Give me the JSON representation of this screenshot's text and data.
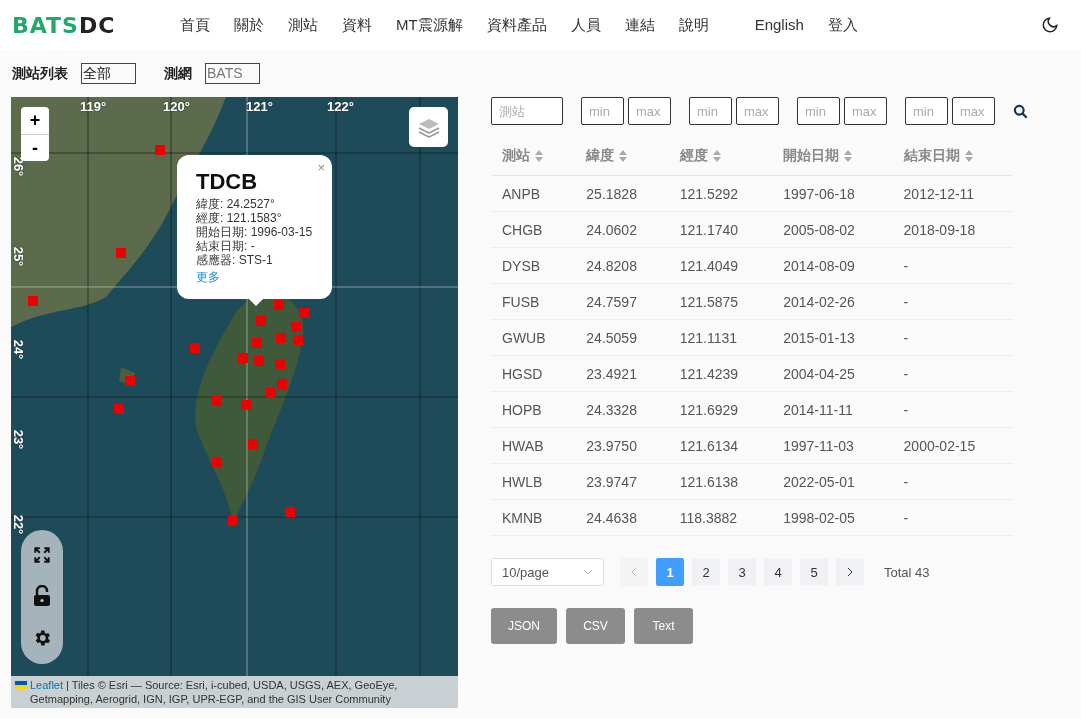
{
  "header": {
    "logo": {
      "accent": "BATS",
      "rest": "DC"
    },
    "nav": [
      "首頁",
      "關於",
      "測站",
      "資料",
      "MT震源解",
      "資料產品",
      "人員",
      "連結",
      "說明"
    ],
    "extra_nav": [
      "English",
      "登入"
    ]
  },
  "filters": [
    {
      "label": "測站列表",
      "value": "全部"
    },
    {
      "label": "測網",
      "value": "BATS"
    }
  ],
  "map": {
    "lon_labels": [
      "119°",
      "120°",
      "121°",
      "122°"
    ],
    "lat_labels": [
      "26°",
      "25°",
      "24°",
      "23°",
      "22°"
    ],
    "zoom_in": "+",
    "zoom_out": "-",
    "popup": {
      "title": "TDCB",
      "close": "×",
      "lines": [
        "緯度: 24.2527°",
        "經度: 121.1583°",
        "開始日期: 1996-03-15",
        "結束日期: -",
        "感應器: STS-1"
      ],
      "link": "更多"
    },
    "attribution": {
      "link": "Leaflet",
      "text": "| Tiles © Esri — Source: Esri, i-cubed, USDA, USGS, AEX, GeoEye, Getmapping, Aerogrid, IGN, IGP, UPR-EGP, and the GIS User Community"
    }
  },
  "search": {
    "station_placeholder": "測站",
    "ranges": [
      {
        "min_placeholder": "min",
        "max_placeholder": "max"
      },
      {
        "min_placeholder": "min",
        "max_placeholder": "max"
      },
      {
        "min_placeholder": "min",
        "max_placeholder": "max"
      },
      {
        "min_placeholder": "min",
        "max_placeholder": "max"
      }
    ]
  },
  "table": {
    "columns": [
      "測站",
      "緯度",
      "經度",
      "開始日期",
      "結束日期"
    ],
    "rows": [
      [
        "ANPB",
        "25.1828",
        "121.5292",
        "1997-06-18",
        "2012-12-11"
      ],
      [
        "CHGB",
        "24.0602",
        "121.1740",
        "2005-08-02",
        "2018-09-18"
      ],
      [
        "DYSB",
        "24.8208",
        "121.4049",
        "2014-08-09",
        "-"
      ],
      [
        "FUSB",
        "24.7597",
        "121.5875",
        "2014-02-26",
        "-"
      ],
      [
        "GWUB",
        "24.5059",
        "121.1131",
        "2015-01-13",
        "-"
      ],
      [
        "HGSD",
        "23.4921",
        "121.4239",
        "2004-04-25",
        "-"
      ],
      [
        "HOPB",
        "24.3328",
        "121.6929",
        "2014-11-11",
        "-"
      ],
      [
        "HWAB",
        "23.9750",
        "121.6134",
        "1997-11-03",
        "2000-02-15"
      ],
      [
        "HWLB",
        "23.9747",
        "121.6138",
        "2022-05-01",
        "-"
      ],
      [
        "KMNB",
        "24.4638",
        "118.3882",
        "1998-02-05",
        "-"
      ]
    ]
  },
  "pagination": {
    "page_size": "10/page",
    "prev_disabled": true,
    "pages": [
      {
        "label": "1",
        "selected": true
      },
      {
        "label": "2",
        "selected": false
      },
      {
        "label": "3",
        "selected": false
      },
      {
        "label": "4",
        "selected": false
      },
      {
        "label": "5",
        "selected": false
      }
    ],
    "total": "Total 43"
  },
  "exports": [
    "JSON",
    "CSV",
    "Text"
  ]
}
